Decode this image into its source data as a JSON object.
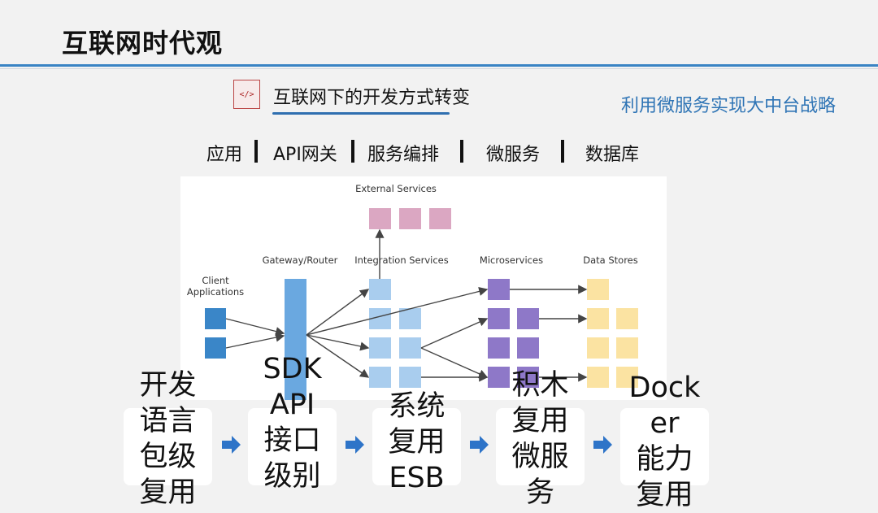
{
  "header": {
    "title": "互联网时代观"
  },
  "subheader": {
    "icon_name": "code-tag-icon",
    "icon_text": "</>",
    "title": "互联网下的开发方式转变"
  },
  "slogan": "利用微服务实现大中台战略",
  "layers": [
    "应用",
    "API网关",
    "服务编排",
    "微服务",
    "数据库"
  ],
  "diagram": {
    "external_services": "External Services",
    "client_applications_line1": "Client",
    "client_applications_line2": "Applications",
    "gateway_router": "Gateway/Router",
    "integration_services": "Integration Services",
    "microservices": "Microservices",
    "data_stores": "Data Stores",
    "colors": {
      "client": "#3a86c8",
      "gateway": "#6aa8e0",
      "integration": "#a9cdee",
      "external": "#dba7c2",
      "micro": "#8e78c8",
      "store": "#fbe3a2",
      "arrow": "#444444"
    }
  },
  "steps": [
    {
      "text": "开发\n语言\n包级\n复用"
    },
    {
      "text": "SDK\nAPI\n接口\n级别"
    },
    {
      "text": "系统\n复用\nESB"
    },
    {
      "text": "积木\n复用\n微服\n务"
    },
    {
      "text": "Dock\ner\n能力\n复用"
    }
  ],
  "step_arrow_color": "#2e74c8"
}
